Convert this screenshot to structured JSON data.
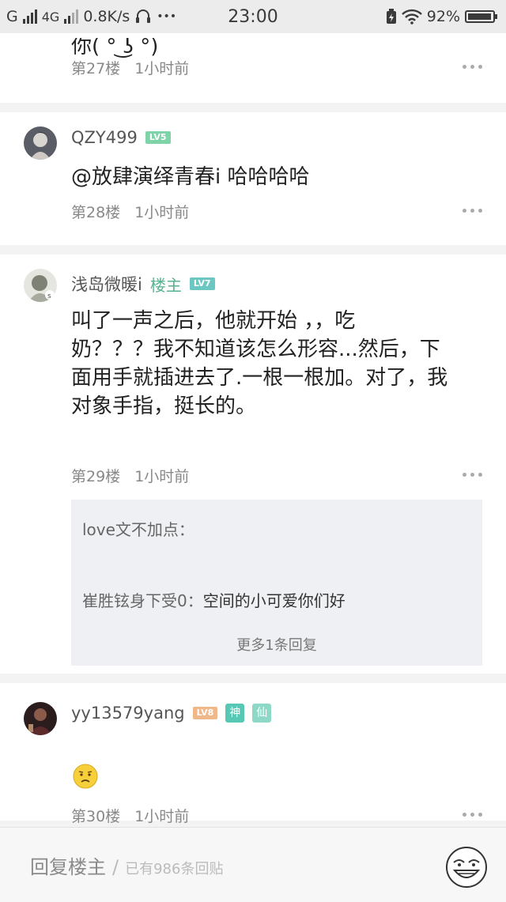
{
  "status_bar": {
    "carrier_1": "G",
    "carrier_2": "4G",
    "net_speed": "0.8K/s",
    "more": "•••",
    "time": "23:00",
    "battery": "92%"
  },
  "posts": [
    {
      "partial_text": "你( ͡° ͜ʖ ͡°)",
      "floor": "第27楼",
      "time": "1小时前"
    },
    {
      "username": "QZY499",
      "level": "LV5",
      "text": "@放肆演绎青春i  哈哈哈哈",
      "floor": "第28楼",
      "time": "1小时前"
    },
    {
      "username": "浅岛微暖i",
      "owner_tag": "楼主",
      "level": "LV7",
      "text_lines": [
        "叫了一声之后，他就开始 ，，吃",
        "奶？？？我不知道该怎么形容...然后，下",
        "面用手就插进去了.一根一根加。对了，我",
        "对象手指，挺长的。"
      ],
      "floor": "第29楼",
      "time": "1小时前",
      "replies": [
        {
          "author": "love文不加点：",
          "text": ""
        },
        {
          "author": "崔胜铉身下受0：",
          "text": "空间的小可爱你们好"
        }
      ],
      "more_replies": "更多1条回复"
    },
    {
      "username": "yy13579yang",
      "level": "LV8",
      "chips": [
        "神",
        "仙"
      ],
      "floor": "第30楼",
      "time": "1小时前"
    }
  ],
  "bottom_bar": {
    "reply_label": "回复楼主",
    "reply_sep": "/",
    "reply_count": "已有986条回贴"
  }
}
